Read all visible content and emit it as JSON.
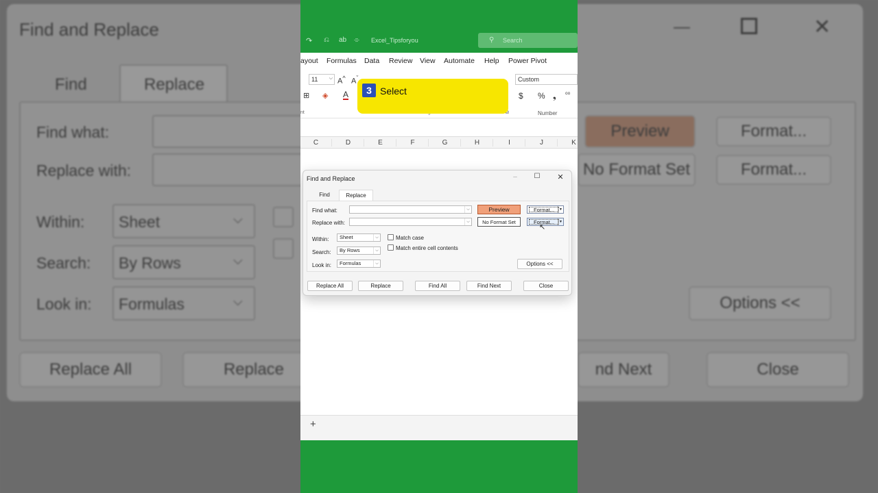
{
  "background_dialog": {
    "title": "Find and Replace",
    "tabs": [
      "Find",
      "Replace"
    ],
    "find_what_label": "Find what:",
    "replace_with_label": "Replace with:",
    "within_label": "Within:",
    "within_value": "Sheet",
    "search_label": "Search:",
    "search_value": "By Rows",
    "look_in_label": "Look in:",
    "look_in_value": "Formulas",
    "preview_label": "Preview",
    "no_format_label": "No Format Set",
    "format_label": "Format...",
    "options_label": "Options <<",
    "replace_all_label": "Replace All",
    "replace_label": "Replace",
    "find_next_label": "nd Next",
    "close_label": "Close"
  },
  "excel": {
    "file_name": "Excel_Tipsforyou",
    "search_placeholder": "Search",
    "ribbon_tabs": [
      "ayout",
      "Formulas",
      "Data",
      "Review",
      "View",
      "Automate",
      "Help",
      "Power Pivot"
    ],
    "font_size": "11",
    "number_format": "Custom",
    "group_labels": [
      "nt",
      "Alignment",
      "Number"
    ],
    "columns": [
      "C",
      "D",
      "E",
      "F",
      "G",
      "H",
      "I",
      "J",
      "K"
    ],
    "add_sheet": "+"
  },
  "callout": {
    "step": "3",
    "label": "Select"
  },
  "dialog": {
    "title": "Find and Replace",
    "tabs": [
      "Find",
      "Replace"
    ],
    "active_tab": "Replace",
    "find_what_label": "Find what:",
    "find_what_value": "",
    "replace_with_label": "Replace with:",
    "replace_with_value": "",
    "preview_label": "Preview",
    "no_format_label": "No Format Set",
    "format_label": "Format...",
    "within_label": "Within:",
    "within_value": "Sheet",
    "search_label": "Search:",
    "search_value": "By Rows",
    "look_in_label": "Look in:",
    "look_in_value": "Formulas",
    "match_case_label": "Match case",
    "match_entire_label": "Match entire cell contents",
    "options_label": "Options <<",
    "buttons": {
      "replace_all": "Replace All",
      "replace": "Replace",
      "find_all": "Find All",
      "find_next": "Find Next",
      "close": "Close"
    }
  },
  "colors": {
    "excel_green": "#1e9a3a",
    "preview_fill": "#f0a07a",
    "callout_yellow": "#f7e600",
    "step_badge": "#2b4fb8"
  }
}
